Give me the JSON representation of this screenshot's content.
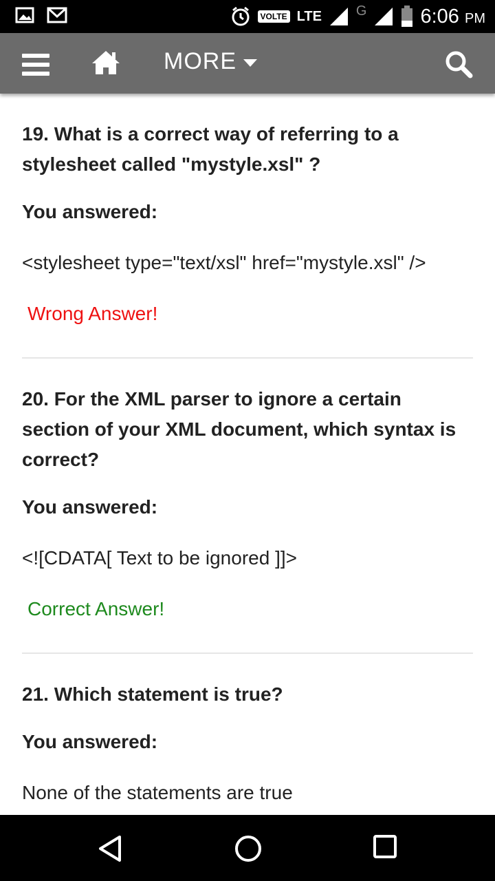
{
  "status_bar": {
    "volte": "VOLTE",
    "lte": "LTE",
    "network_g": "G",
    "time": "6:06",
    "ampm": "PM",
    "icons": [
      "gallery-icon",
      "gmail-icon",
      "alarm-icon",
      "signal-icon",
      "battery-icon"
    ]
  },
  "app_bar": {
    "more_label": "MORE",
    "icons": [
      "menu-icon",
      "home-icon",
      "caret-down-icon",
      "search-icon"
    ],
    "background": "#6b6b6b"
  },
  "questions": [
    {
      "title": "19. What is a correct way of referring to a stylesheet called \"mystyle.xsl\" ?",
      "you_answered": "You answered:",
      "answer": "<stylesheet type=\"text/xsl\" href=\"mystyle.xsl\" />",
      "result": "Wrong Answer!"
    },
    {
      "title": "20. For the XML parser to ignore a certain section of your XML document, which syntax is correct?",
      "you_answered": "You answered:",
      "answer": "<![CDATA[ Text to be ignored ]]>",
      "result": "Correct Answer!"
    },
    {
      "title": "21. Which statement is true?",
      "you_answered": "You answered:",
      "answer": "None of the statements are true"
    }
  ],
  "colors": {
    "wrong": "#ee1111",
    "correct": "#1e8a1e"
  },
  "nav_bar": {
    "icons": [
      "back-icon",
      "home-circle-icon",
      "recents-icon"
    ]
  }
}
